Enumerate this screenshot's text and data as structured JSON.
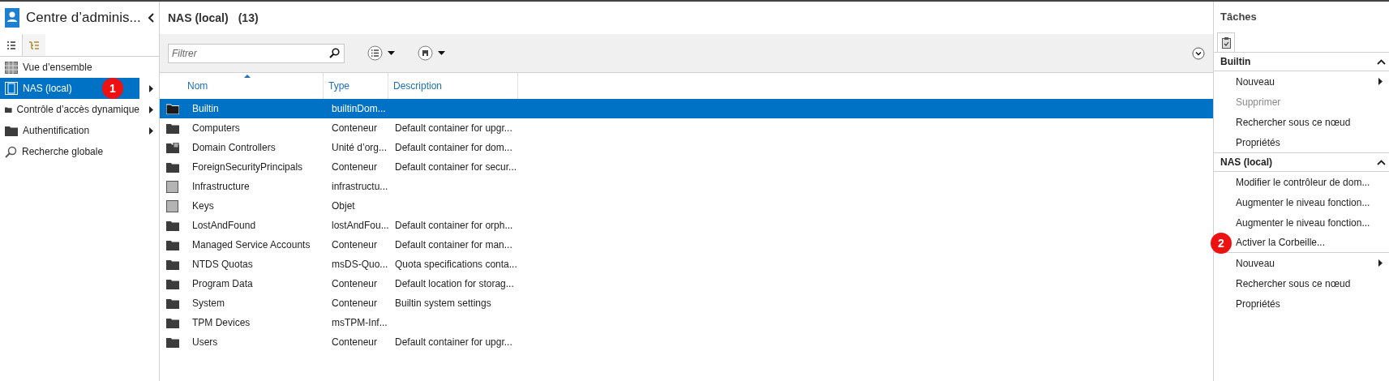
{
  "sidebar": {
    "title": "Centre d’adminis...",
    "tabs": [
      {
        "kind": "list",
        "selected": true
      },
      {
        "kind": "tree",
        "selected": false
      }
    ],
    "items": [
      {
        "label": "Vue d’ensemble",
        "kind": "overview",
        "selected": false,
        "submenu": false
      },
      {
        "label": "NAS (local)",
        "kind": "domain",
        "selected": true,
        "submenu": true,
        "badge": "1"
      },
      {
        "label": "Contrôle d’accès dynamique",
        "kind": "folder",
        "selected": false,
        "submenu": true
      },
      {
        "label": "Authentification",
        "kind": "folder",
        "selected": false,
        "submenu": true
      },
      {
        "label": "Recherche globale",
        "kind": "search",
        "selected": false,
        "submenu": false
      }
    ]
  },
  "main": {
    "title": "NAS (local)",
    "count": "(13)",
    "filter": {
      "placeholder": "Filtrer"
    },
    "columns": [
      {
        "label": "Nom",
        "sorted": true
      },
      {
        "label": "Type",
        "sorted": false
      },
      {
        "label": "Description",
        "sorted": false
      }
    ],
    "rows": [
      {
        "kind": "folder",
        "selected": true,
        "name": "Builtin",
        "type": "builtinDom...",
        "description": ""
      },
      {
        "kind": "folder",
        "selected": false,
        "name": "Computers",
        "type": "Conteneur",
        "description": "Default container for upgr..."
      },
      {
        "kind": "ou",
        "selected": false,
        "name": "Domain Controllers",
        "type": "Unité d’org...",
        "description": "Default container for dom..."
      },
      {
        "kind": "folder",
        "selected": false,
        "name": "ForeignSecurityPrincipals",
        "type": "Conteneur",
        "description": "Default container for secur..."
      },
      {
        "kind": "object",
        "selected": false,
        "name": "Infrastructure",
        "type": "infrastructu...",
        "description": ""
      },
      {
        "kind": "object",
        "selected": false,
        "name": "Keys",
        "type": "Objet",
        "description": ""
      },
      {
        "kind": "folder",
        "selected": false,
        "name": "LostAndFound",
        "type": "lostAndFou...",
        "description": "Default container for orph..."
      },
      {
        "kind": "folder",
        "selected": false,
        "name": "Managed Service Accounts",
        "type": "Conteneur",
        "description": "Default container for man..."
      },
      {
        "kind": "folder",
        "selected": false,
        "name": "NTDS Quotas",
        "type": "msDS-Quo...",
        "description": "Quota specifications conta..."
      },
      {
        "kind": "folder",
        "selected": false,
        "name": "Program Data",
        "type": "Conteneur",
        "description": "Default location for storag..."
      },
      {
        "kind": "folder",
        "selected": false,
        "name": "System",
        "type": "Conteneur",
        "description": "Builtin system settings"
      },
      {
        "kind": "folder",
        "selected": false,
        "name": "TPM Devices",
        "type": "msTPM-Inf...",
        "description": ""
      },
      {
        "kind": "folder",
        "selected": false,
        "name": "Users",
        "type": "Conteneur",
        "description": "Default container for upgr..."
      }
    ]
  },
  "tasks": {
    "title": "Tâches",
    "sections": [
      {
        "title": "Builtin",
        "expanded": true,
        "items": [
          {
            "label": "Nouveau",
            "disabled": false,
            "submenu": true,
            "separator_after": false
          },
          {
            "label": "Supprimer",
            "disabled": true,
            "submenu": false,
            "separator_after": false
          },
          {
            "label": "Rechercher sous ce nœud",
            "disabled": false,
            "submenu": false,
            "separator_after": false
          },
          {
            "label": "Propriétés",
            "disabled": false,
            "submenu": false,
            "separator_after": false
          }
        ]
      },
      {
        "title": "NAS (local)",
        "expanded": true,
        "items": [
          {
            "label": "Modifier le contrôleur de dom...",
            "disabled": false,
            "submenu": false,
            "separator_after": false
          },
          {
            "label": "Augmenter le niveau fonction...",
            "disabled": false,
            "submenu": false,
            "separator_after": false
          },
          {
            "label": "Augmenter le niveau fonction...",
            "disabled": false,
            "submenu": false,
            "separator_after": false
          },
          {
            "label": "Activer la Corbeille...",
            "disabled": false,
            "submenu": false,
            "separator_after": true,
            "badge": "2"
          },
          {
            "label": "Nouveau",
            "disabled": false,
            "submenu": true,
            "separator_after": false
          },
          {
            "label": "Rechercher sous ce nœud",
            "disabled": false,
            "submenu": false,
            "separator_after": false
          },
          {
            "label": "Propriétés",
            "disabled": false,
            "submenu": false,
            "separator_after": false
          }
        ]
      }
    ]
  }
}
